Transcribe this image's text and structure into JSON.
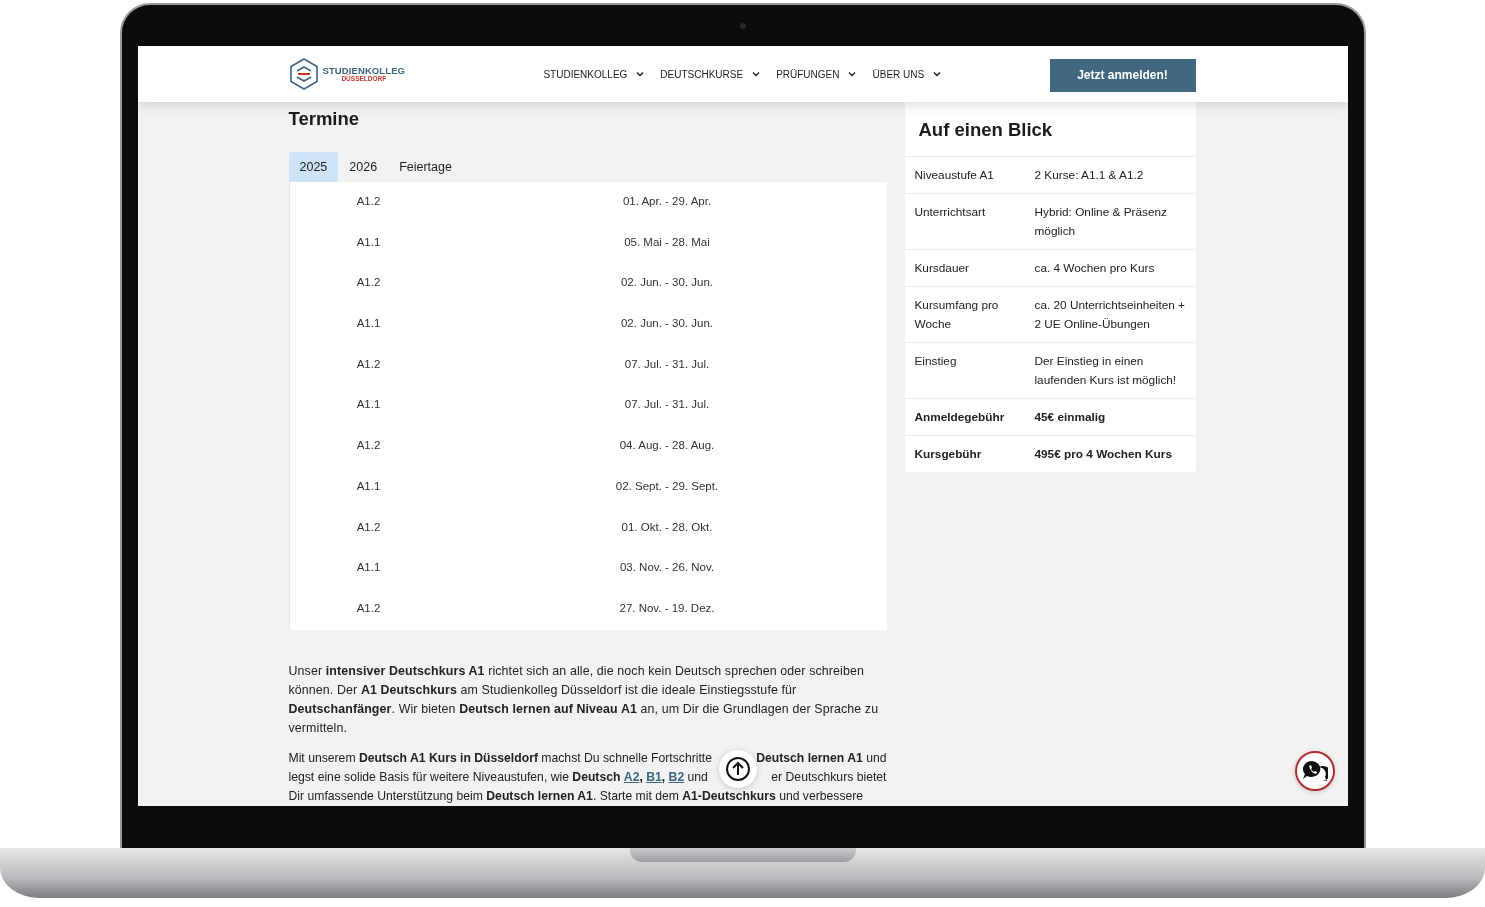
{
  "header": {
    "logo": {
      "name": "STUDIENKOLLEG",
      "city": "DÜSSELDORF"
    },
    "nav": [
      {
        "label": "STUDIENKOLLEG"
      },
      {
        "label": "DEUTSCHKURSE"
      },
      {
        "label": "PRÜFUNGEN"
      },
      {
        "label": "ÜBER UNS"
      }
    ],
    "cta": "Jetzt anmelden!"
  },
  "termine": {
    "title": "Termine",
    "tabs": [
      {
        "label": "2025",
        "selected": true
      },
      {
        "label": "2026",
        "selected": false
      },
      {
        "label": "Feiertage",
        "selected": false
      }
    ],
    "rows": [
      {
        "level": "A1.2",
        "dates": "01. Apr. - 29. Apr."
      },
      {
        "level": "A1.1",
        "dates": "05. Mai - 28. Mai"
      },
      {
        "level": "A1.2",
        "dates": "02. Jun. - 30. Jun."
      },
      {
        "level": "A1.1",
        "dates": "02. Jun. - 30. Jun."
      },
      {
        "level": "A1.2",
        "dates": "07. Jul. - 31. Jul."
      },
      {
        "level": "A1.1",
        "dates": "07. Jul. - 31. Jul."
      },
      {
        "level": "A1.2",
        "dates": "04. Aug. - 28. Aug."
      },
      {
        "level": "A1.1",
        "dates": "02. Sept. - 29. Sept."
      },
      {
        "level": "A1.2",
        "dates": "01. Okt. - 28. Okt."
      },
      {
        "level": "A1.1",
        "dates": "03. Nov. - 26. Nov."
      },
      {
        "level": "A1.2",
        "dates": "27. Nov. - 19. Dez."
      }
    ]
  },
  "intro": "Unser **intensiver Deutschkurs A1** richtet sich an alle, die noch kein Deutsch sprechen oder schreiben können. Der **A1 Deutschkurs** am Studienkolleg Düsseldorf ist die ideale Einstiegsstufe für **Deutschanfänger**. Wir bieten **Deutsch lernen auf Niveau A1** an, um Dir die Grundlagen der Sprache zu vermitteln.",
  "paragraph_2_lines": [
    {
      "segments": [
        {
          "kind": "text",
          "text": "Mit unserem **Deutsch A1 Kurs in Düsseldorf** machst Du schnelle Fortschritte"
        }
      ],
      "after": [
        {
          "kind": "text",
          "text": "**Deutsch lernen A1** und"
        }
      ]
    },
    {
      "segments": [
        {
          "kind": "text",
          "text": "legst eine solide Basis für weitere Niveaustufen, wie **Deutsch** "
        },
        {
          "kind": "link",
          "text": "A2"
        },
        {
          "kind": "text",
          "text": "**,** "
        },
        {
          "kind": "link",
          "text": "B1"
        },
        {
          "kind": "text",
          "text": "**,** "
        },
        {
          "kind": "link",
          "text": "B2"
        },
        {
          "kind": "text",
          "text": " und"
        }
      ],
      "after": [
        {
          "kind": "text",
          "text": "er Deutschkurs bietet"
        }
      ]
    },
    {
      "segments": [
        {
          "kind": "text",
          "text": "Dir umfassende Unterstützung beim **Deutsch lernen A1**. Starte mit dem **A1-Deutschkurs** und verbessere"
        }
      ]
    }
  ],
  "overview": {
    "title": "Auf einen Blick",
    "rows": [
      {
        "label": "Niveaustufe A1",
        "value": "2 Kurse: A1.1 & A1.2",
        "emphasized": false
      },
      {
        "label": "Unterrichtsart",
        "value": "Hybrid: Online & Präsenz möglich",
        "emphasized": false
      },
      {
        "label": "Kursdauer",
        "value": "ca. 4 Wochen pro Kurs",
        "emphasized": false
      },
      {
        "label": "Kursumfang pro Woche",
        "value": "ca. 20 Unterrichtseinheiten + 2 UE Online-Übungen",
        "emphasized": false
      },
      {
        "label": "Einstieg",
        "value": "Der Einstieg in einen laufenden Kurs ist möglich!",
        "emphasized": false
      },
      {
        "label": "Anmeldegebühr",
        "value": "45€ einmalig",
        "emphasized": true
      },
      {
        "label": "Kursgebühr",
        "value": "495€ pro 4 Wochen Kurs",
        "emphasized": true
      }
    ]
  }
}
